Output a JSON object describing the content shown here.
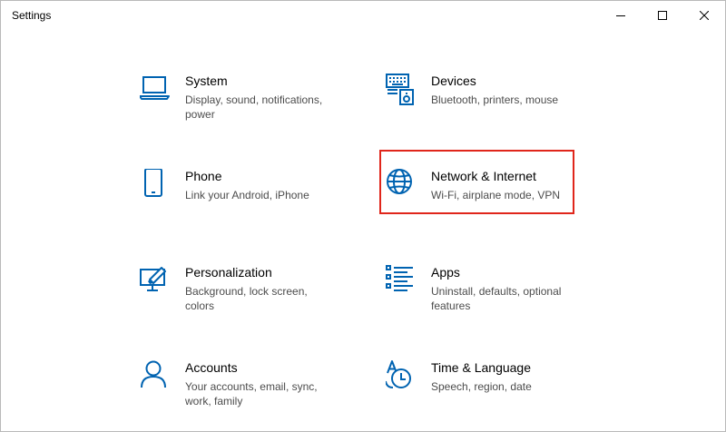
{
  "window": {
    "title": "Settings",
    "controls": {
      "minimize_icon": "minimize-icon",
      "maximize_icon": "maximize-icon",
      "close_icon": "close-icon"
    }
  },
  "accent_color": "#0063b1",
  "highlight_color": "#e0261b",
  "tiles": [
    {
      "name": "System",
      "desc": "Display, sound, notifications, power",
      "icon": "laptop-icon"
    },
    {
      "name": "Devices",
      "desc": "Bluetooth, printers, mouse",
      "icon": "devices-icon"
    },
    {
      "name": "Phone",
      "desc": "Link your Android, iPhone",
      "icon": "phone-icon"
    },
    {
      "name": "Network & Internet",
      "desc": "Wi-Fi, airplane mode, VPN",
      "icon": "globe-icon",
      "highlighted": true
    },
    {
      "name": "Personalization",
      "desc": "Background, lock screen, colors",
      "icon": "personalization-icon"
    },
    {
      "name": "Apps",
      "desc": "Uninstall, defaults, optional features",
      "icon": "apps-list-icon"
    },
    {
      "name": "Accounts",
      "desc": "Your accounts, email, sync, work, family",
      "icon": "person-icon"
    },
    {
      "name": "Time & Language",
      "desc": "Speech, region, date",
      "icon": "time-language-icon"
    }
  ]
}
